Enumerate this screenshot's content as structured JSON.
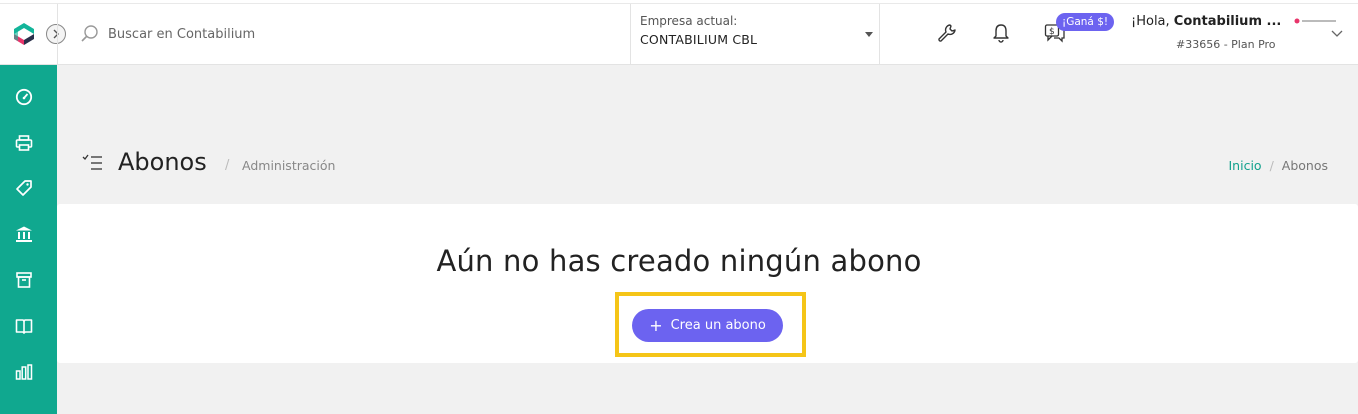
{
  "header": {
    "search": {
      "placeholder": "Buscar en Contabilium"
    },
    "company": {
      "label": "Empresa actual:",
      "name": "CONTABILIUM CBL"
    },
    "promo_badge": "¡Ganá $!",
    "user": {
      "greeting": "¡Hola, ",
      "name": "Contabilium ...",
      "plan": "#33656 - Plan Pro"
    },
    "icons": [
      "wrench-icon",
      "bell-icon",
      "referral-chat-icon",
      "chevron-down-icon"
    ]
  },
  "sidebar": {
    "items": [
      {
        "name": "dashboard",
        "icon": "speedometer-icon"
      },
      {
        "name": "ventas",
        "icon": "printer-icon"
      },
      {
        "name": "compras",
        "icon": "tag-icon"
      },
      {
        "name": "tesoreria",
        "icon": "bank-icon"
      },
      {
        "name": "inventario",
        "icon": "box-icon"
      },
      {
        "name": "contabilidad",
        "icon": "book-icon"
      },
      {
        "name": "reportes",
        "icon": "bar-chart-icon"
      }
    ]
  },
  "page": {
    "title": "Abonos",
    "separator": "/",
    "subtitle": "Administración",
    "breadcrumb": {
      "home": "Inicio",
      "separator": "/",
      "current": "Abonos"
    }
  },
  "empty_state": {
    "message": "Aún no has creado ningún abono",
    "button_label": "Crea un abono",
    "button_icon": "+"
  },
  "colors": {
    "brand_teal": "#10a88f",
    "accent_purple": "#6c63f0",
    "highlight_yellow": "#f5c518"
  }
}
